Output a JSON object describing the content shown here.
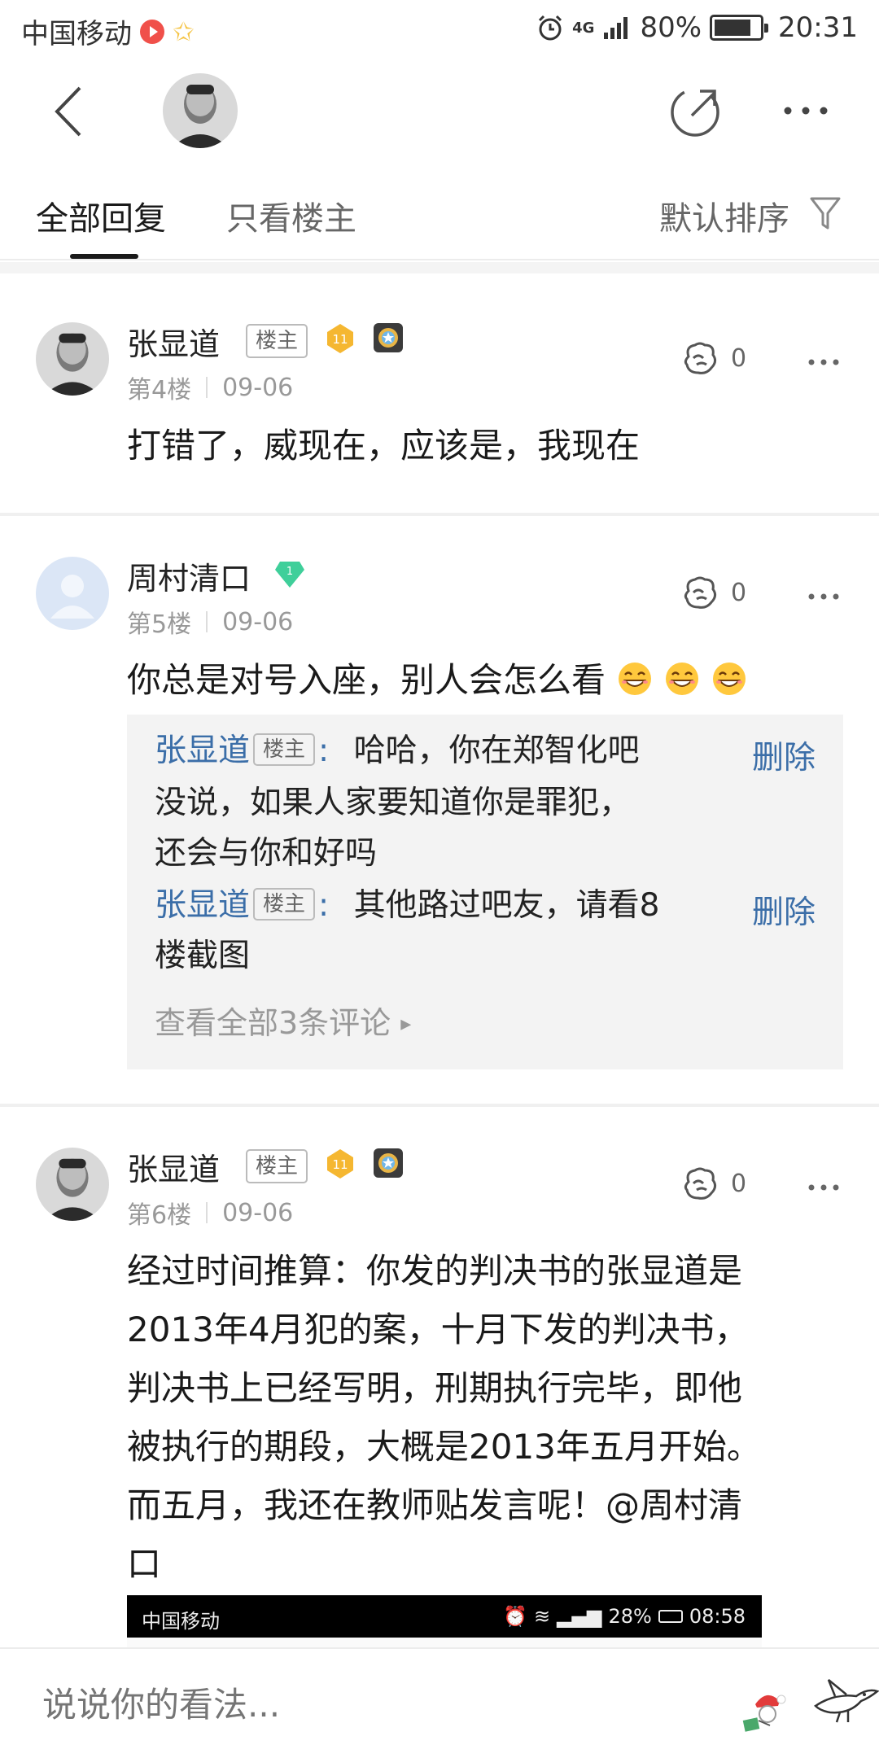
{
  "status_bar": {
    "carrier": "中国移动",
    "network": "4G",
    "battery": "80%",
    "time": "20:31"
  },
  "nav": {
    "back_icon": "chevron-left-icon",
    "share_icon": "share-icon",
    "more_icon": "more-icon"
  },
  "tabs": {
    "all_replies": "全部回复",
    "op_only": "只看楼主",
    "sort": "默认排序",
    "active": "all_replies"
  },
  "posts": [
    {
      "username": "张显道",
      "op_badge": "楼主",
      "level": "11",
      "floor": "第4楼",
      "date": "09-06",
      "likes": "0",
      "content": "打错了，威现在，应该是，我现在"
    },
    {
      "username": "周村清口",
      "level": "1",
      "floor": "第5楼",
      "date": "09-06",
      "likes": "0",
      "content": "你总是对号入座，别人会怎么看",
      "replies": [
        {
          "name": "张显道",
          "badge": "楼主",
          "text_first": "哈哈，你在郑智化吧",
          "text_rest": [
            "没说，如果人家要知道你是罪犯，",
            "还会与你和好吗"
          ],
          "delete": "删除"
        },
        {
          "name": "张显道",
          "badge": "楼主",
          "text_first": "其他路过吧友，请看8",
          "text_rest": [
            "楼截图"
          ],
          "delete": "删除"
        }
      ],
      "view_all": "查看全部3条评论"
    },
    {
      "username": "张显道",
      "op_badge": "楼主",
      "level": "11",
      "floor": "第6楼",
      "date": "09-06",
      "likes": "0",
      "content_lines": [
        "经过时间推算：你发的判决书的张显道是",
        "2013年4月犯的案，十月下发的判决书，",
        "判决书上已经写明，刑期执行完毕，即他",
        "被执行的期段，大概是2013年五月开始。",
        "而五月，我还在教师贴发言呢！@周村清",
        "口"
      ]
    }
  ],
  "embedded_screenshot": {
    "carrier": "中国移动",
    "battery": "28%",
    "time": "08:58"
  },
  "comment_bar": {
    "placeholder": "说说你的看法..."
  },
  "colors": {
    "link_blue": "#3b6ea8",
    "gold_badge": "#f5b731",
    "green_badge": "#3fcf9a",
    "reply_bg": "#f3f3f3"
  }
}
